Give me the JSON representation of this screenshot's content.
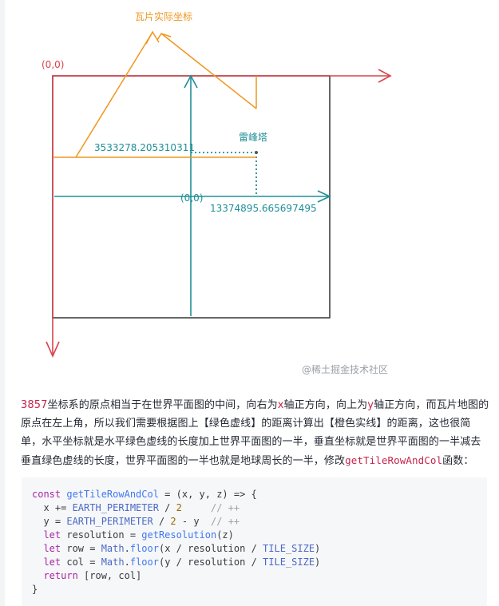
{
  "diagram": {
    "tile_coord_label": "瓦片实际坐标",
    "tile_origin_label": "(0,0)",
    "center_origin_label": "(0,0)",
    "landmark_label": "雷峰塔",
    "y_distance_value": "3533278.205310311",
    "x_distance_value": "13374895.665697495",
    "watermark": "@稀土掘金技术社区",
    "colors": {
      "red": "#d9434e",
      "orange": "#f0961e",
      "green": "#1f8f98",
      "frame": "#333333"
    }
  },
  "paragraph": {
    "p1": "3857",
    "p2": "坐标系的原点相当于在世界平面图的中间，向右为",
    "p3": "x",
    "p4": "轴正方向，向上为",
    "p5": "y",
    "p6": "轴正方向，而瓦片地图的原点在左上角，所以我们需要根据图上【绿色虚线】的距离计算出【橙色实线】的距离，这也很简单，水平坐标就是水平绿色虚线的长度加上世界平面图的一半，垂直坐标就是世界平面图的一半减去垂直绿色虚线的长度，世界平面图的一半也就是地球周长的一半，修改",
    "p7": "getTileRowAndCol",
    "p8": "函数："
  },
  "code": {
    "l1_kw": "const",
    "l1_fn": "getTileRowAndCol",
    "l1_rest": " = (x, y, z) => {",
    "l2_a": "  x += ",
    "l2_c": "EARTH_PERIMETER",
    "l2_b": " / ",
    "l2_n": "2",
    "l2_cm": "     // ++",
    "l3_a": "  y = ",
    "l3_c": "EARTH_PERIMETER",
    "l3_b": " / ",
    "l3_n": "2",
    "l3_d": " - y  ",
    "l3_cm": "// ++",
    "l4_kw": "  let",
    "l4_a": " resolution = ",
    "l4_fn": "getResolution",
    "l4_b": "(z)",
    "l5_kw": "  let",
    "l5_a": " row = ",
    "l5_c": "Math",
    "l5_b": ".",
    "l5_fn": "floor",
    "l5_d": "(x / resolution / ",
    "l5_c2": "TILE_SIZE",
    "l5_e": ")",
    "l6_kw": "  let",
    "l6_a": " col = ",
    "l6_c": "Math",
    "l6_b": ".",
    "l6_fn": "floor",
    "l6_d": "(y / resolution / ",
    "l6_c2": "TILE_SIZE",
    "l6_e": ")",
    "l7_kw": "  return",
    "l7_a": " [row, col]",
    "l8": "}"
  }
}
